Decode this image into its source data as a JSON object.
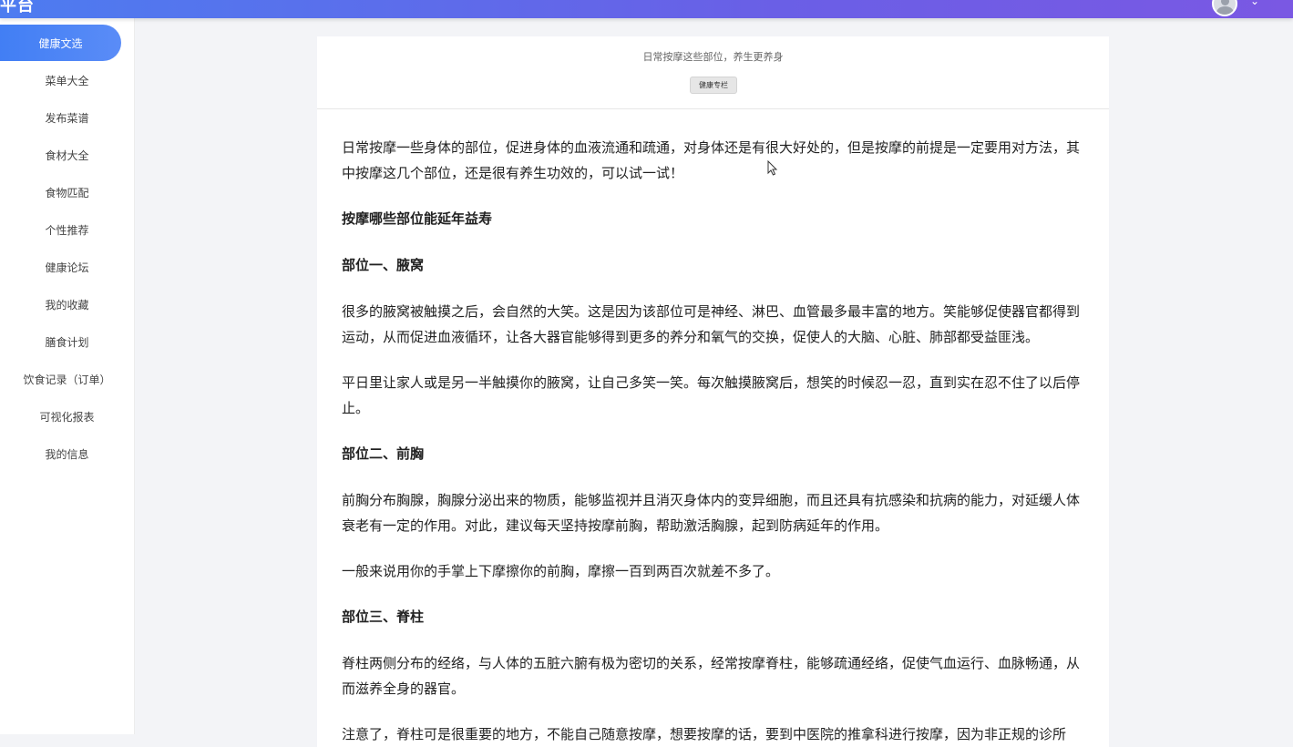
{
  "header": {
    "title": "平台",
    "caret": "⌄"
  },
  "sidebar": {
    "items": [
      {
        "label": "健康文选",
        "active": true
      },
      {
        "label": "菜单大全"
      },
      {
        "label": "发布菜谱"
      },
      {
        "label": "食材大全"
      },
      {
        "label": "食物匹配"
      },
      {
        "label": "个性推荐"
      },
      {
        "label": "健康论坛"
      },
      {
        "label": "我的收藏"
      },
      {
        "label": "膳食计划"
      },
      {
        "label": "饮食记录（订单）"
      },
      {
        "label": "可视化报表"
      },
      {
        "label": "我的信息"
      }
    ]
  },
  "article": {
    "subtitle": "日常按摩这些部位，养生更养身",
    "tag": "健康专栏",
    "paragraphs": [
      "日常按摩一些身体的部位，促进身体的血液流通和疏通，对身体还是有很大好处的，但是按摩的前提是一定要用对方法，其中按摩这几个部位，还是很有养生功效的，可以试一试！",
      "按摩哪些部位能延年益寿",
      "部位一、腋窝",
      "很多的腋窝被触摸之后，会自然的大笑。这是因为该部位可是神经、淋巴、血管最多最丰富的地方。笑能够促使器官都得到运动，从而促进血液循环，让各大器官能够得到更多的养分和氧气的交换，促使人的大脑、心脏、肺部都受益匪浅。",
      "平日里让家人或是另一半触摸你的腋窝，让自己多笑一笑。每次触摸腋窝后，想笑的时候忍一忍，直到实在忍不住了以后停止。",
      "部位二、前胸",
      "前胸分布胸腺，胸腺分泌出来的物质，能够监视并且消灭身体内的变异细胞，而且还具有抗感染和抗病的能力，对延缓人体衰老有一定的作用。对此，建议每天坚持按摩前胸，帮助激活胸腺，起到防病延年的作用。",
      "一般来说用你的手掌上下摩擦你的前胸，摩擦一百到两百次就差不多了。",
      "部位三、脊柱",
      "脊柱两侧分布的经络，与人体的五脏六腑有极为密切的关系，经常按摩脊柱，能够疏通经络，促使气血运行、血脉畅通，从而滋养全身的器官。",
      "注意了，脊柱可是很重要的地方，不能自己随意按摩，想要按摩的话，要到中医院的推拿科进行按摩，因为非正规的诊所"
    ]
  }
}
